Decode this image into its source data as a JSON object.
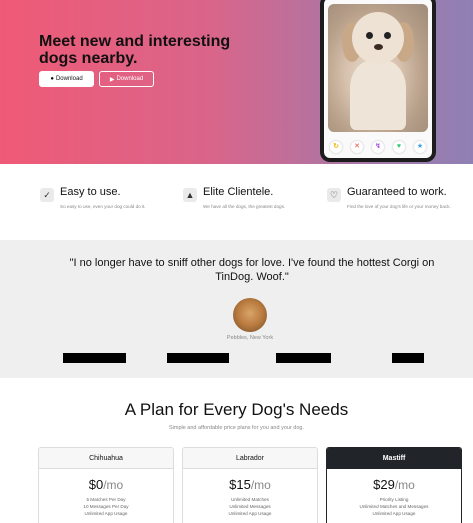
{
  "hero": {
    "title": "Meet new and interesting dogs nearby.",
    "download_button_1": "Download",
    "download_button_2": "Download",
    "action_icons": [
      "undo-icon",
      "close-icon",
      "bolt-icon",
      "heart-icon",
      "star-icon"
    ]
  },
  "features": [
    {
      "title": "Easy to use.",
      "description": "So easy to use, even your dog could do it.",
      "icon": "check-circle-icon"
    },
    {
      "title": "Elite Clientele.",
      "description": "We have all the dogs, the greatest dogs.",
      "icon": "graduation-cap-icon"
    },
    {
      "title": "Guaranteed to work.",
      "description": "Find the love of your dog's life or your money back.",
      "icon": "heart-icon"
    }
  ],
  "testimonial": {
    "quote": "\"I no longer have to sniff other dogs for love. I've found the hottest Corgi on TinDog. Woof.\"",
    "name": "Pebbles, New York"
  },
  "pricing": {
    "title": "A Plan for Every Dog's Needs",
    "subtitle": "Simple and affordable price plans for you and your dog.",
    "plans": [
      {
        "name": "Chihuahua",
        "price": "$0",
        "per": "/mo",
        "features": [
          "5 Matches Per Day",
          "10 Messages Per Day",
          "Unlimited App Usage"
        ]
      },
      {
        "name": "Labrador",
        "price": "$15",
        "per": "/mo",
        "features": [
          "Unlimited Matches",
          "Unlimited Messages",
          "Unlimited App Usage"
        ]
      },
      {
        "name": "Mastiff",
        "price": "$29",
        "per": "/mo",
        "features": [
          "Priority Listing",
          "Unlimited Matches and Messages",
          "Unlimited App Usage"
        ]
      }
    ]
  },
  "colors": {
    "hero_start": "#ef5a76",
    "hero_end": "#8f80b4",
    "dark": "#212529"
  }
}
